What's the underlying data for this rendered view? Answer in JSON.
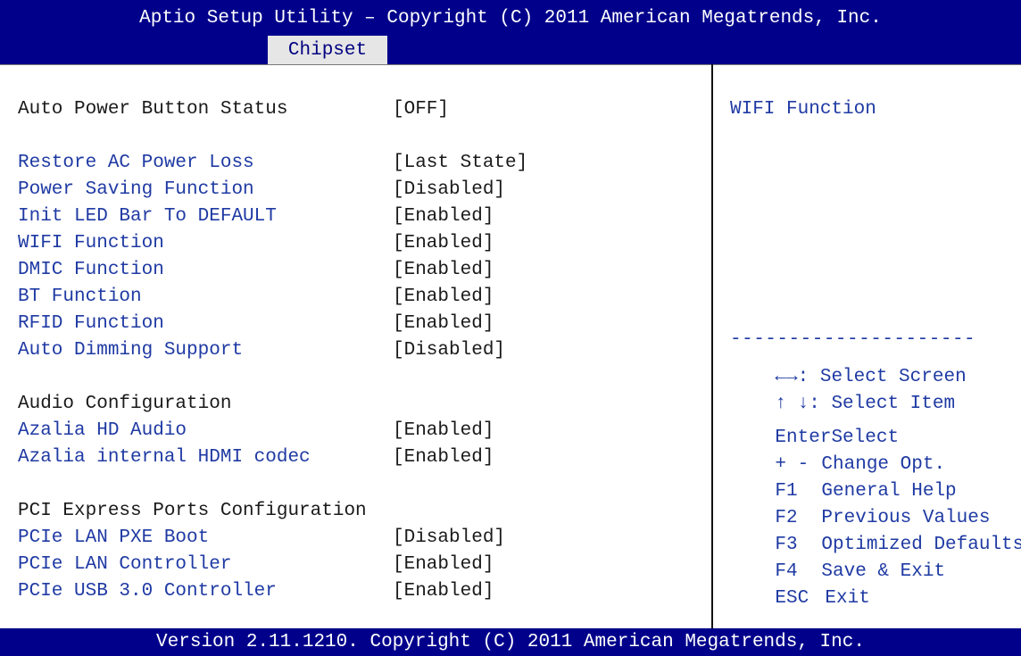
{
  "header": {
    "title": "Aptio Setup Utility – Copyright (C) 2011 American Megatrends, Inc.",
    "active_tab": "Chipset"
  },
  "settings": [
    {
      "label": "Auto Power Button Status",
      "value": "[OFF]",
      "editable": false
    },
    {
      "label": "Restore AC Power Loss",
      "value": "[Last State]",
      "editable": true
    },
    {
      "label": "Power Saving Function",
      "value": "[Disabled]",
      "editable": true
    },
    {
      "label": "Init LED Bar To DEFAULT",
      "value": "[Enabled]",
      "editable": true
    },
    {
      "label": "WIFI Function",
      "value": "[Enabled]",
      "editable": true
    },
    {
      "label": "DMIC Function",
      "value": "[Enabled]",
      "editable": true
    },
    {
      "label": "BT Function",
      "value": "[Enabled]",
      "editable": true
    },
    {
      "label": "RFID Function",
      "value": "[Enabled]",
      "editable": true
    },
    {
      "label": "Auto Dimming Support",
      "value": "[Disabled]",
      "editable": true
    },
    {
      "label": "Audio Configuration",
      "value": "",
      "editable": false
    },
    {
      "label": "Azalia HD Audio",
      "value": "[Enabled]",
      "editable": true
    },
    {
      "label": "Azalia internal HDMI codec",
      "value": "[Enabled]",
      "editable": true
    },
    {
      "label": "PCI Express Ports Configuration",
      "value": "",
      "editable": false
    },
    {
      "label": "PCIe LAN PXE Boot",
      "value": "[Disabled]",
      "editable": true
    },
    {
      "label": "PCIe LAN Controller",
      "value": "[Enabled]",
      "editable": true
    },
    {
      "label": "PCIe USB 3.0 Controller",
      "value": "[Enabled]",
      "editable": true
    }
  ],
  "help": {
    "text": "WIFI Function",
    "divider": "---------------------"
  },
  "keys": [
    {
      "key": "←→",
      "desc": ": Select Screen",
      "icon": "left-right-arrow-icon"
    },
    {
      "key": "↑ ↓",
      "desc": ": Select Item",
      "icon": "up-down-arrow-icon"
    },
    {
      "key": "Enter",
      "desc": "Select"
    },
    {
      "key": "+ -",
      "desc": "Change Opt."
    },
    {
      "key": "F1",
      "desc": "General Help"
    },
    {
      "key": "F2",
      "desc": "Previous Values"
    },
    {
      "key": "F3",
      "desc": "Optimized Defaults"
    },
    {
      "key": "F4",
      "desc": "Save & Exit"
    },
    {
      "key": "ESC",
      "desc": "Exit"
    }
  ],
  "footer": {
    "text": "Version 2.11.1210. Copyright (C) 2011 American Megatrends, Inc."
  },
  "colors": {
    "header_bg": "#00008b",
    "tab_bg": "#e6e6e6",
    "link_text": "#1f3aa3",
    "static_text": "#1a1a1a"
  }
}
